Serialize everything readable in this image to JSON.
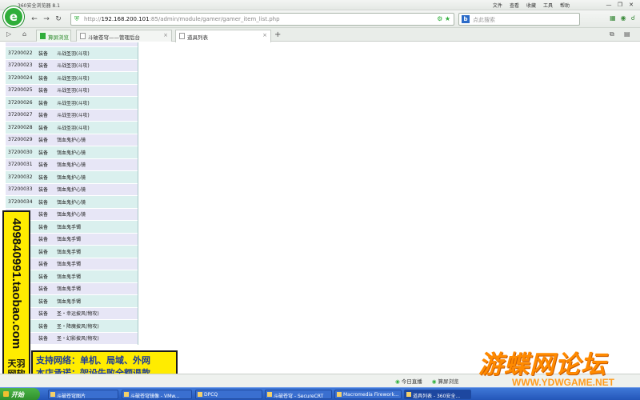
{
  "browser": {
    "app_title": "360安全浏览器 8.1",
    "logo_glyph": "e",
    "menus": [
      "文件",
      "查看",
      "收藏",
      "工具",
      "帮助"
    ],
    "window_buttons": [
      "—",
      "❐",
      "✕"
    ],
    "url_base": "http://",
    "url_host": "192.168.200.101",
    "url_rest": ":85/admin/module/gamer/gamer_item_list.php",
    "search_placeholder": "点此搜索",
    "search_engine_glyph": "b"
  },
  "tabs": [
    {
      "label": "算屏浏览",
      "active": false,
      "closable": false,
      "green": true
    },
    {
      "label": "斗破苍穹——管理后台",
      "active": false,
      "closable": true
    },
    {
      "label": "道具列表",
      "active": true,
      "closable": true
    }
  ],
  "table": {
    "rows": [
      {
        "id": "",
        "type": "",
        "name": "",
        "cut": true
      },
      {
        "id": "37200022",
        "type": "装备",
        "name": "斗战圣羽(斗攻)"
      },
      {
        "id": "37200023",
        "type": "装备",
        "name": "斗战圣羽(斗攻)"
      },
      {
        "id": "37200024",
        "type": "装备",
        "name": "斗战圣羽(斗攻)"
      },
      {
        "id": "37200025",
        "type": "装备",
        "name": "斗战圣羽(斗攻)"
      },
      {
        "id": "37200026",
        "type": "装备",
        "name": "斗战圣羽(斗攻)"
      },
      {
        "id": "37200027",
        "type": "装备",
        "name": "斗战圣羽(斗攻)"
      },
      {
        "id": "37200028",
        "type": "装备",
        "name": "斗战圣羽(斗攻)"
      },
      {
        "id": "37200029",
        "type": "装备",
        "name": "饵血鬼护心镜"
      },
      {
        "id": "37200030",
        "type": "装备",
        "name": "饵血鬼护心镜"
      },
      {
        "id": "37200031",
        "type": "装备",
        "name": "饵血鬼护心镜"
      },
      {
        "id": "37200032",
        "type": "装备",
        "name": "饵血鬼护心镜"
      },
      {
        "id": "37200033",
        "type": "装备",
        "name": "饵血鬼护心镜"
      },
      {
        "id": "37200034",
        "type": "装备",
        "name": "饵血鬼护心镜"
      },
      {
        "id": "",
        "type": "装备",
        "name": "饵血鬼护心镜"
      },
      {
        "id": "",
        "type": "装备",
        "name": "饵血鬼手镯"
      },
      {
        "id": "",
        "type": "装备",
        "name": "饵血鬼手镯"
      },
      {
        "id": "",
        "type": "装备",
        "name": "饵血鬼手镯"
      },
      {
        "id": "",
        "type": "装备",
        "name": "饵血鬼手镯"
      },
      {
        "id": "",
        "type": "装备",
        "name": "饵血鬼手镯"
      },
      {
        "id": "",
        "type": "装备",
        "name": "饵血鬼手镯"
      },
      {
        "id": "",
        "type": "装备",
        "name": "饵血鬼手镯"
      },
      {
        "id": "",
        "type": "装备",
        "name": "圣・幸运披风(物攻)"
      },
      {
        "id": "",
        "type": "装备",
        "name": "圣・降魔披风(物攻)"
      },
      {
        "id": "",
        "type": "装备",
        "name": "圣・幻影披风(物攻)"
      }
    ]
  },
  "promo": {
    "vertical_text": "409840991.taobao.com",
    "brand_line1": "天羽",
    "brand_line2": "网软",
    "line1": "支持网络：单机、局域、外网",
    "line2": "本店承诺：架设失败全额退款"
  },
  "statusbar": {
    "items": [
      "今日直播",
      "算屏浏览"
    ]
  },
  "watermark": {
    "big": "游蝶网论坛",
    "small": "WWW.YDWGAME.NET"
  },
  "taskbar": {
    "start": "开始",
    "tasks": [
      {
        "label": "斗破苍穹图片",
        "active": false
      },
      {
        "label": "斗破苍穹镜像 - VMw...",
        "active": false
      },
      {
        "label": "DPCQ",
        "active": false
      },
      {
        "label": "斗破苍穹 - SecureCRT",
        "active": false
      },
      {
        "label": "Macromedia Firework...",
        "active": false
      },
      {
        "label": "道具列表 - 360安全...",
        "active": true
      }
    ]
  }
}
